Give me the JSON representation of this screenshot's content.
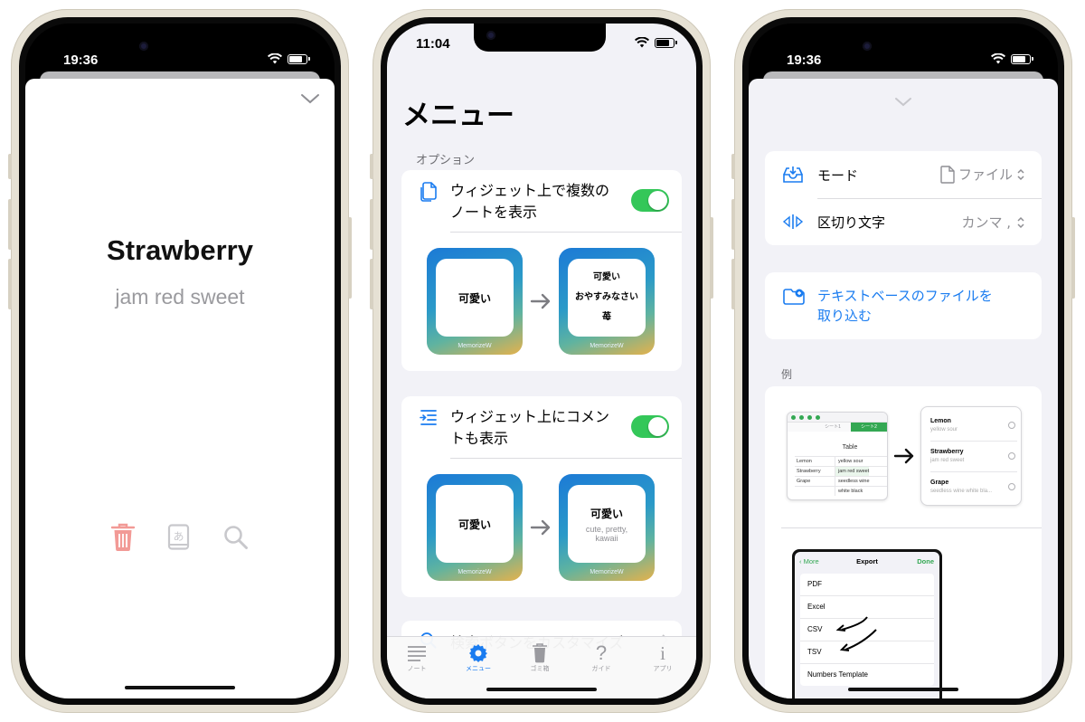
{
  "phones": [
    {
      "status_time": "19:36",
      "card": {
        "title": "Strawberry",
        "subtitle": "jam red sweet"
      },
      "actions": [
        "trash-icon",
        "dictionary-icon",
        "search-icon"
      ],
      "colors": {
        "trash": "#f29a96",
        "icons": "#c8c8cc"
      }
    },
    {
      "status_time": "11:04",
      "title": "メニュー",
      "section_header": "オプション",
      "options": [
        {
          "label_line1": "ウィジェット上で複数の",
          "label_line2": "ノートを表示",
          "toggle_on": true,
          "widget_before": {
            "text": "可愛い",
            "brand": "MemorizeW"
          },
          "widget_after": {
            "line1": "可愛い",
            "line2": "おやすみなさい",
            "line3": "苺",
            "brand": "MemorizeW"
          }
        },
        {
          "label_line1": "ウィジェット上にコメン",
          "label_line2": "トも表示",
          "toggle_on": true,
          "widget_before": {
            "text": "可愛い",
            "brand": "MemorizeW"
          },
          "widget_after": {
            "line1": "可愛い",
            "line2": "cute, pretty,",
            "line3": "kawaii",
            "brand": "MemorizeW"
          }
        }
      ],
      "partial_row": "検索ボタンをカスタマイズ",
      "tabs": [
        {
          "label": "ノート",
          "icon": "list-icon",
          "active": false
        },
        {
          "label": "メニュー",
          "icon": "gear-icon",
          "active": true
        },
        {
          "label": "ゴミ箱",
          "icon": "trash-icon",
          "active": false
        },
        {
          "label": "ガイド",
          "icon": "question-icon",
          "active": false
        },
        {
          "label": "アプリ",
          "icon": "info-icon",
          "active": false
        }
      ],
      "accent": "#1a7cf0"
    },
    {
      "status_time": "19:36",
      "settings": [
        {
          "label": "モード",
          "value": "ファイル"
        },
        {
          "label": "区切り文字",
          "value": "カンマ ,"
        }
      ],
      "import_label_line1": "テキストベースのファイルを",
      "import_label_line2": "取り込む",
      "example_header": "例",
      "sheet": {
        "tab1": "シート1",
        "tab2": "シート2",
        "table_title": "Table",
        "rows": [
          [
            "Lemon",
            "yellow sour"
          ],
          [
            "Strawberry",
            "jam red sweet"
          ],
          [
            "Grape",
            "seedless wine"
          ],
          [
            "",
            "white black"
          ]
        ]
      },
      "list_preview": [
        {
          "title": "Lemon",
          "sub": "yellow sour"
        },
        {
          "title": "Strawberry",
          "sub": "jam red sweet"
        },
        {
          "title": "Grape",
          "sub": "seedless wine white bla..."
        }
      ],
      "export": {
        "back": "More",
        "title": "Export",
        "done": "Done",
        "items": [
          "PDF",
          "Excel",
          "CSV",
          "TSV",
          "Numbers Template"
        ]
      },
      "accent": "#1a7cf0"
    }
  ]
}
